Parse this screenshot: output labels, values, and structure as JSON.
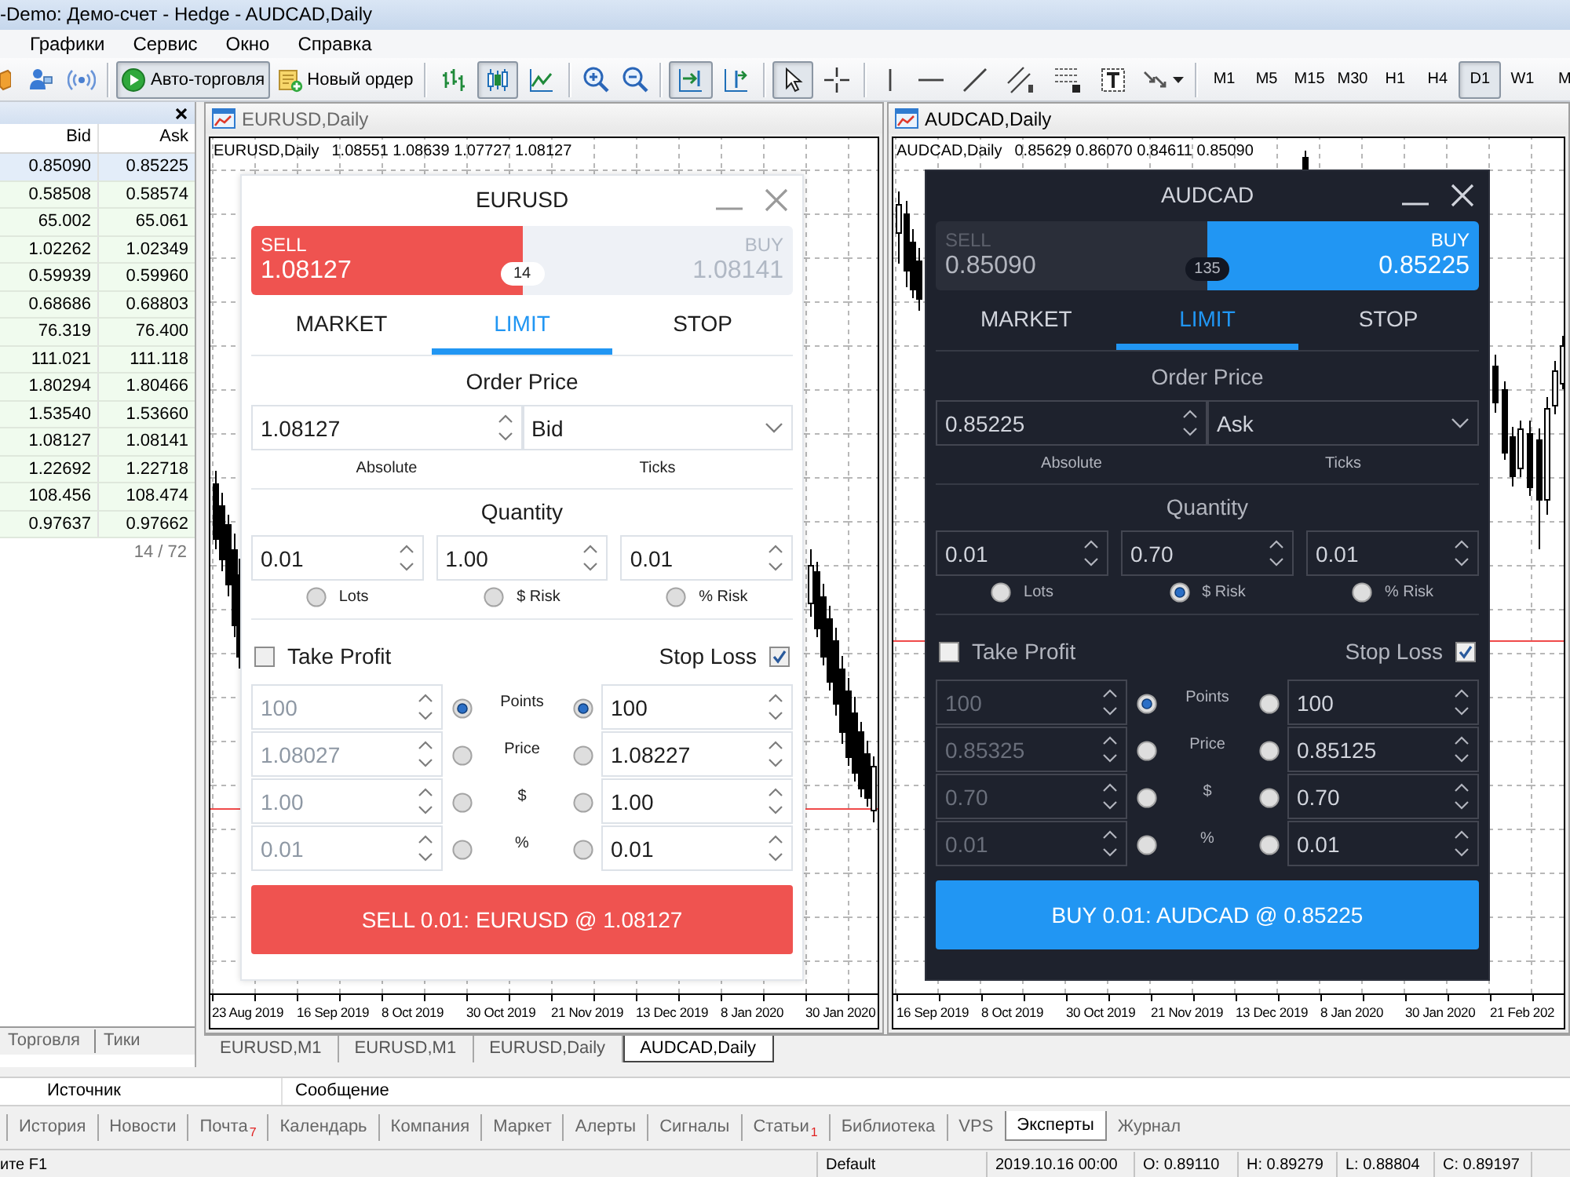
{
  "window": {
    "title": "-Demo: Демо-счет - Hedge - AUDCAD,Daily"
  },
  "menu": [
    "Графики",
    "Сервис",
    "Окно",
    "Справка"
  ],
  "toolbar": {
    "auto_trading": {
      "label": "Авто-торговля",
      "pressed": true
    },
    "new_order": {
      "label": "Новый ордер"
    },
    "chart_types": [
      {
        "selected": false
      },
      {
        "selected": true
      },
      {
        "selected": false
      }
    ],
    "auto_scroll": {
      "pressed": true
    },
    "chart_shift": {
      "pressed": false
    },
    "cursor_modes": [
      {
        "selected": true
      },
      {
        "selected": false
      }
    ],
    "timeframes": [
      {
        "label": "M1",
        "selected": false
      },
      {
        "label": "M5",
        "selected": false
      },
      {
        "label": "M15",
        "selected": false
      },
      {
        "label": "M30",
        "selected": false
      },
      {
        "label": "H1",
        "selected": false
      },
      {
        "label": "H4",
        "selected": false
      },
      {
        "label": "D1",
        "selected": true
      },
      {
        "label": "W1",
        "selected": false
      },
      {
        "label": "M",
        "selected": false
      }
    ]
  },
  "market_watch": {
    "columns": [
      "Bid",
      "Ask"
    ],
    "rows": [
      {
        "bid": "0.85090",
        "ask": "0.85225",
        "selected": true
      },
      {
        "bid": "0.58508",
        "ask": "0.58574",
        "selected": false
      },
      {
        "bid": "65.002",
        "ask": "65.061",
        "selected": false
      },
      {
        "bid": "1.02262",
        "ask": "1.02349",
        "selected": false
      },
      {
        "bid": "0.59939",
        "ask": "0.59960",
        "selected": false
      },
      {
        "bid": "0.68686",
        "ask": "0.68803",
        "selected": false
      },
      {
        "bid": "76.319",
        "ask": "76.400",
        "selected": false
      },
      {
        "bid": "111.021",
        "ask": "111.118",
        "selected": false
      },
      {
        "bid": "1.80294",
        "ask": "1.80466",
        "selected": false
      },
      {
        "bid": "1.53540",
        "ask": "1.53660",
        "selected": false
      },
      {
        "bid": "1.08127",
        "ask": "1.08141",
        "selected": false
      },
      {
        "bid": "1.22692",
        "ask": "1.22718",
        "selected": false
      },
      {
        "bid": "108.456",
        "ask": "108.474",
        "selected": false
      },
      {
        "bid": "0.97637",
        "ask": "0.97662",
        "selected": false
      }
    ],
    "count": "14 / 72",
    "tabs": [
      {
        "label": "Торговля",
        "selected": false
      },
      {
        "label": "Тики",
        "selected": false
      }
    ]
  },
  "charts": [
    {
      "title": "EURUSD,Daily",
      "active": false,
      "symbol_info": "EURUSD,Daily",
      "ohlc": "1.08551 1.08639 1.07727 1.08127",
      "dates": [
        "23 Aug 2019",
        "16 Sep 2019",
        "8 Oct 2019",
        "30 Oct 2019",
        "21 Nov 2019",
        "13 Dec 2019",
        "8 Jan 2020",
        "30 Jan 2020"
      ],
      "dialog": {
        "kind": "light",
        "symbol": "EURUSD",
        "sell": {
          "label": "SELL",
          "price": "1.08127",
          "selected": true
        },
        "buy": {
          "label": "BUY",
          "price": "1.08141",
          "selected": false
        },
        "spread": "14",
        "tabs": [
          {
            "label": "MARKET",
            "selected": false
          },
          {
            "label": "LIMIT",
            "selected": true
          },
          {
            "label": "STOP",
            "selected": false
          }
        ],
        "order_price": {
          "title": "Order Price",
          "value": "1.08127",
          "reference": "Bid",
          "labels": [
            "Absolute",
            "Ticks"
          ]
        },
        "quantity": {
          "title": "Quantity",
          "fields": [
            {
              "value": "0.01",
              "label": "Lots",
              "selected": false
            },
            {
              "value": "1.00",
              "label": "$ Risk",
              "selected": false
            },
            {
              "value": "0.01",
              "label": "% Risk",
              "selected": false
            }
          ]
        },
        "take_profit": {
          "label": "Take Profit",
          "checked": false
        },
        "stop_loss": {
          "label": "Stop Loss",
          "checked": true
        },
        "levels": [
          {
            "label": "Points",
            "tp_value": "100",
            "tp_selected": true,
            "sl_value": "100",
            "sl_selected": true
          },
          {
            "label": "Price",
            "tp_value": "1.08027",
            "tp_selected": false,
            "sl_value": "1.08227",
            "sl_selected": false
          },
          {
            "label": "$",
            "tp_value": "1.00",
            "tp_selected": false,
            "sl_value": "1.00",
            "sl_selected": false
          },
          {
            "label": "%",
            "tp_value": "0.01",
            "tp_selected": false,
            "sl_value": "0.01",
            "sl_selected": false
          }
        ],
        "submit": "SELL 0.01: EURUSD @ 1.08127"
      }
    },
    {
      "title": "AUDCAD,Daily",
      "active": true,
      "symbol_info": "AUDCAD,Daily",
      "ohlc": "0.85629 0.86070 0.84611 0.85090",
      "dates": [
        "16 Sep 2019",
        "8 Oct 2019",
        "30 Oct 2019",
        "21 Nov 2019",
        "13 Dec 2019",
        "8 Jan 2020",
        "30 Jan 2020",
        "21 Feb 202"
      ],
      "dialog": {
        "kind": "dark",
        "symbol": "AUDCAD",
        "sell": {
          "label": "SELL",
          "price": "0.85090",
          "selected": false
        },
        "buy": {
          "label": "BUY",
          "price": "0.85225",
          "selected": true
        },
        "spread": "135",
        "tabs": [
          {
            "label": "MARKET",
            "selected": false
          },
          {
            "label": "LIMIT",
            "selected": true
          },
          {
            "label": "STOP",
            "selected": false
          }
        ],
        "order_price": {
          "title": "Order Price",
          "value": "0.85225",
          "reference": "Ask",
          "labels": [
            "Absolute",
            "Ticks"
          ]
        },
        "quantity": {
          "title": "Quantity",
          "fields": [
            {
              "value": "0.01",
              "label": "Lots",
              "selected": false
            },
            {
              "value": "0.70",
              "label": "$ Risk",
              "selected": true
            },
            {
              "value": "0.01",
              "label": "% Risk",
              "selected": false
            }
          ]
        },
        "take_profit": {
          "label": "Take Profit",
          "checked": false
        },
        "stop_loss": {
          "label": "Stop Loss",
          "checked": true
        },
        "levels": [
          {
            "label": "Points",
            "tp_value": "100",
            "tp_selected": true,
            "sl_value": "100",
            "sl_selected": false
          },
          {
            "label": "Price",
            "tp_value": "0.85325",
            "tp_selected": false,
            "sl_value": "0.85125",
            "sl_selected": false
          },
          {
            "label": "$",
            "tp_value": "0.70",
            "tp_selected": false,
            "sl_value": "0.70",
            "sl_selected": false
          },
          {
            "label": "%",
            "tp_value": "0.01",
            "tp_selected": false,
            "sl_value": "0.01",
            "sl_selected": false
          }
        ],
        "submit": "BUY 0.01: AUDCAD @ 0.85225"
      }
    }
  ],
  "chart_tabs": [
    {
      "label": "EURUSD,M1",
      "selected": false
    },
    {
      "label": "EURUSD,M1",
      "selected": false
    },
    {
      "label": "EURUSD,Daily",
      "selected": false
    },
    {
      "label": "AUDCAD,Daily",
      "selected": true
    }
  ],
  "toolbox": {
    "columns": [
      "Источник",
      "Сообщение"
    ],
    "tabs": [
      {
        "label": "История",
        "selected": false
      },
      {
        "label": "Новости",
        "selected": false
      },
      {
        "label": "Почта",
        "count": "7",
        "selected": false
      },
      {
        "label": "Календарь",
        "selected": false
      },
      {
        "label": "Компания",
        "selected": false
      },
      {
        "label": "Маркет",
        "selected": false
      },
      {
        "label": "Алерты",
        "selected": false
      },
      {
        "label": "Сигналы",
        "selected": false
      },
      {
        "label": "Статьи",
        "count": "1",
        "selected": false
      },
      {
        "label": "Библиотека",
        "selected": false
      },
      {
        "label": "VPS",
        "selected": false
      },
      {
        "label": "Эксперты",
        "selected": true
      },
      {
        "label": "Журнал",
        "selected": false
      }
    ]
  },
  "status_bar": {
    "help": "ите F1",
    "profile": "Default",
    "time": "2019.10.16 00:00",
    "open": "O: 0.89110",
    "high": "H: 0.89279",
    "low": "L: 0.88804",
    "close": "C: 0.89197"
  }
}
